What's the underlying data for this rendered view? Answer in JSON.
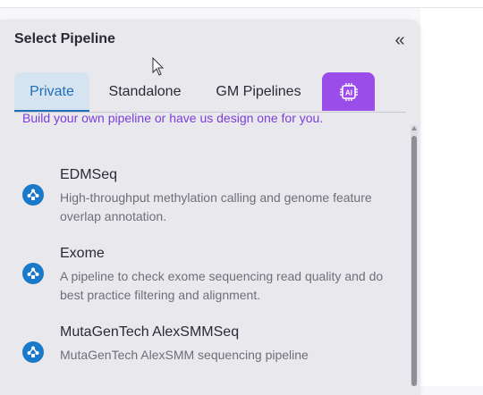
{
  "panel": {
    "title": "Select Pipeline",
    "collapse_icon": "«"
  },
  "tabs": [
    {
      "label": "Private",
      "active": true
    },
    {
      "label": "Standalone",
      "active": false
    },
    {
      "label": "GM Pipelines",
      "active": false
    },
    {
      "label": "AI",
      "icon": "ai-chip-icon",
      "active": false
    }
  ],
  "intro_text": "Build your own pipeline or have us design one for you.",
  "pipelines": [
    {
      "name": "EDMSeq",
      "description": "High-throughput methylation calling and genome feature overlap annotation.",
      "icon": "pipeline-icon"
    },
    {
      "name": "Exome",
      "description": "A pipeline to check exome sequencing read quality and do best practice filtering and alignment.",
      "icon": "pipeline-icon"
    },
    {
      "name": "MutaGenTech AlexSMMSeq",
      "description": "MutaGenTech AlexSMM sequencing pipeline",
      "icon": "pipeline-icon"
    }
  ],
  "colors": {
    "accent_blue": "#1f6fb8",
    "ai_purple": "#9b4dea",
    "intro_purple": "#7b3fd8"
  }
}
